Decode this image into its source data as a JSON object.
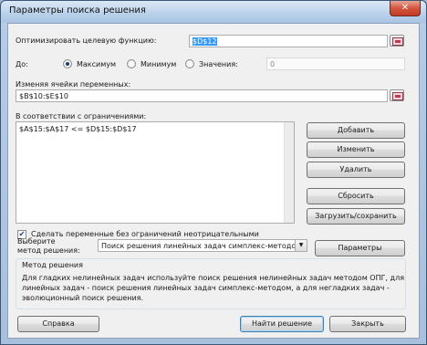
{
  "window": {
    "title": "Параметры поиска решения",
    "close_glyph": "✕"
  },
  "objective": {
    "label": "Оптимизировать целевую функцию:",
    "value": "$D$12"
  },
  "goal": {
    "label": "До:",
    "options": [
      {
        "label": "Максимум",
        "selected": true
      },
      {
        "label": "Минимум",
        "selected": false
      },
      {
        "label": "Значения:",
        "selected": false
      }
    ],
    "value": "0"
  },
  "variables": {
    "label": "Изменяя ячейки переменных:",
    "value": "$B$10:$E$10"
  },
  "constraints": {
    "label": "В соответствии с ограничениями:",
    "items": [
      "$A$15:$A$17 <= $D$15:$D$17"
    ],
    "buttons": {
      "add": "Добавить",
      "change": "Изменить",
      "delete": "Удалить",
      "reset": "Сбросить",
      "load_save": "Загрузить/сохранить"
    }
  },
  "nonnegative": {
    "label": "Сделать переменные без ограничений неотрицательными",
    "checked": true
  },
  "method": {
    "label_line1": "Выберите",
    "label_line2": "метод решения:",
    "selected": "Поиск решения линейных задач симплекс-методом",
    "options_button": "Параметры"
  },
  "method_group": {
    "title": "Метод решения",
    "description_line1": "Для гладких нелинейных задач используйте поиск решения нелинейных задач методом ОПГ, для",
    "description_line2": "линейных задач - поиск решения линейных задач симплекс-методом, а для негладких задач -",
    "description_line3": "эволюционный поиск решения."
  },
  "footer": {
    "help": "Справка",
    "solve": "Найти решение",
    "close": "Закрыть"
  },
  "icons": {
    "ref": "cell-reference-icon",
    "check": "✔",
    "arrow": "▼"
  }
}
